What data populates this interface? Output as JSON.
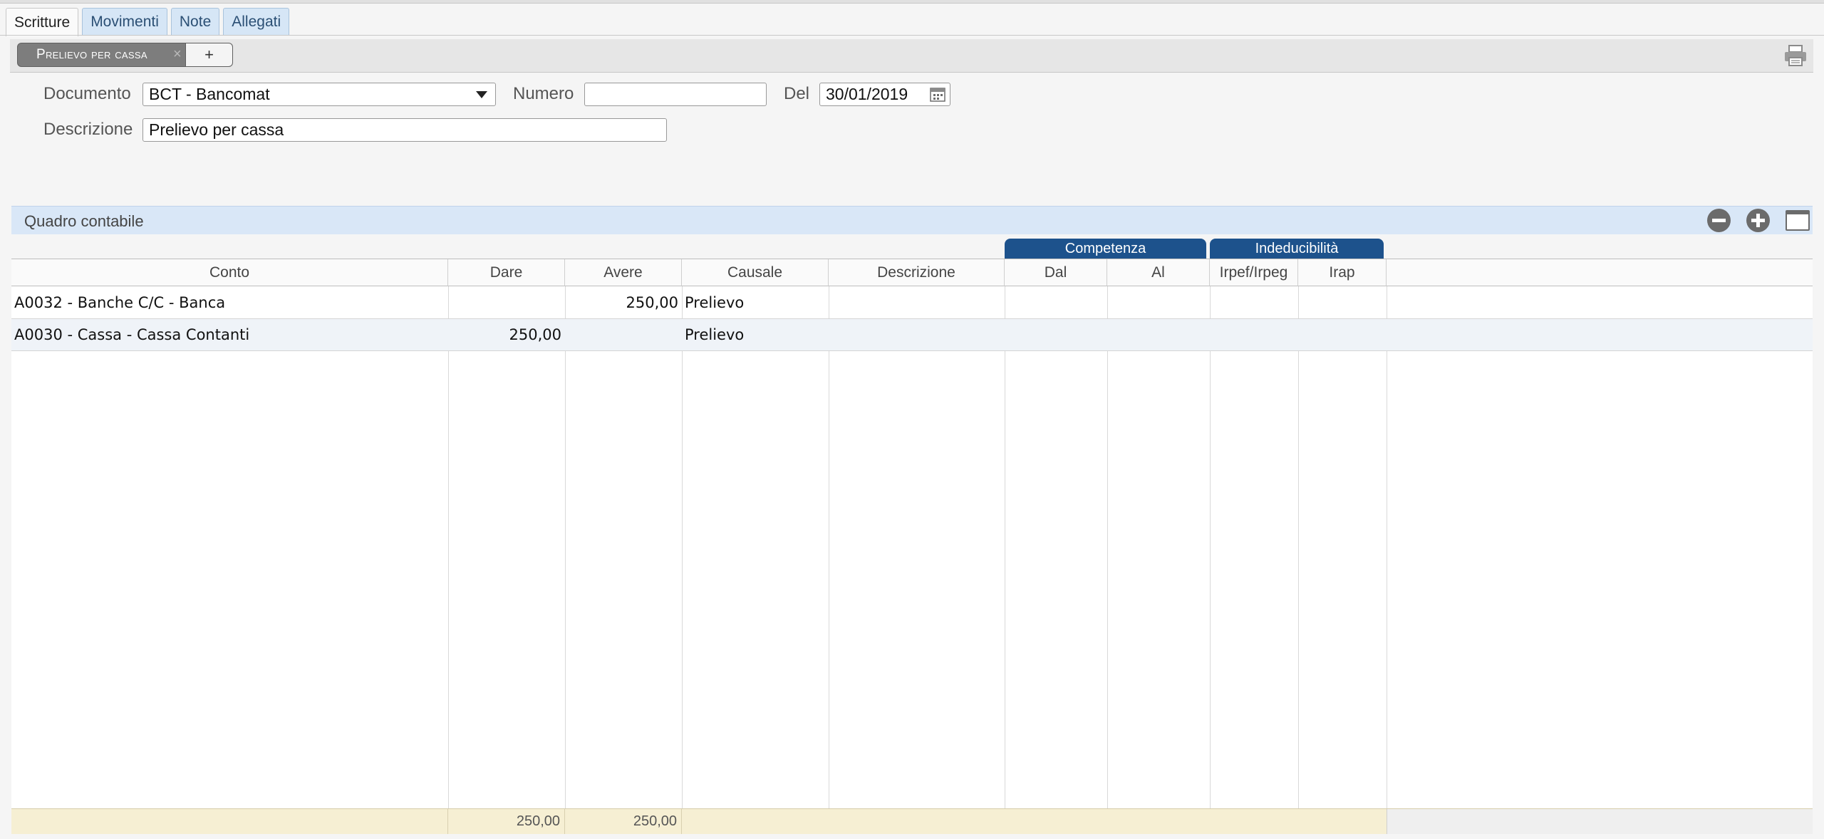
{
  "tabs": [
    {
      "label": "Scritture",
      "active": true
    },
    {
      "label": "Movimenti",
      "active": false
    },
    {
      "label": "Note",
      "active": false
    },
    {
      "label": "Allegati",
      "active": false
    }
  ],
  "subbar": {
    "doc_tab_label": "Prelievo per cassa",
    "close_symbol": "×",
    "add_symbol": "+",
    "print_icon": "printer-icon"
  },
  "form": {
    "documento_label": "Documento",
    "documento_value": "BCT - Bancomat",
    "numero_label": "Numero",
    "numero_value": "",
    "del_label": "Del",
    "del_value": "30/01/2019",
    "descrizione_label": "Descrizione",
    "descrizione_value": "Prelievo per cassa"
  },
  "panel": {
    "title": "Quadro contabile",
    "icons": [
      "minus-circle-icon",
      "plus-circle-icon",
      "window-icon"
    ]
  },
  "groups": {
    "competenza": "Competenza",
    "indeducibilita": "Indeducibilità"
  },
  "columns": [
    "Conto",
    "Dare",
    "Avere",
    "Causale",
    "Descrizione",
    "Dal",
    "Al",
    "Irpef/Irpeg",
    "Irap"
  ],
  "rows": [
    {
      "conto": "A0032 - Banche C/C - Banca",
      "dare": "",
      "avere": "250,00",
      "causale": "Prelievo",
      "descrizione": "",
      "dal": "",
      "al": "",
      "irpef": "",
      "irap": ""
    },
    {
      "conto": "A0030 - Cassa - Cassa Contanti",
      "dare": "250,00",
      "avere": "",
      "causale": "Prelievo",
      "descrizione": "",
      "dal": "",
      "al": "",
      "irpef": "",
      "irap": ""
    }
  ],
  "totals": {
    "dare": "250,00",
    "avere": "250,00"
  },
  "colors": {
    "accent": "#1d528c",
    "tab_bg": "#d6e6f6",
    "panel_bg": "#d9e7f7",
    "footer_bg": "#f6efd3"
  }
}
